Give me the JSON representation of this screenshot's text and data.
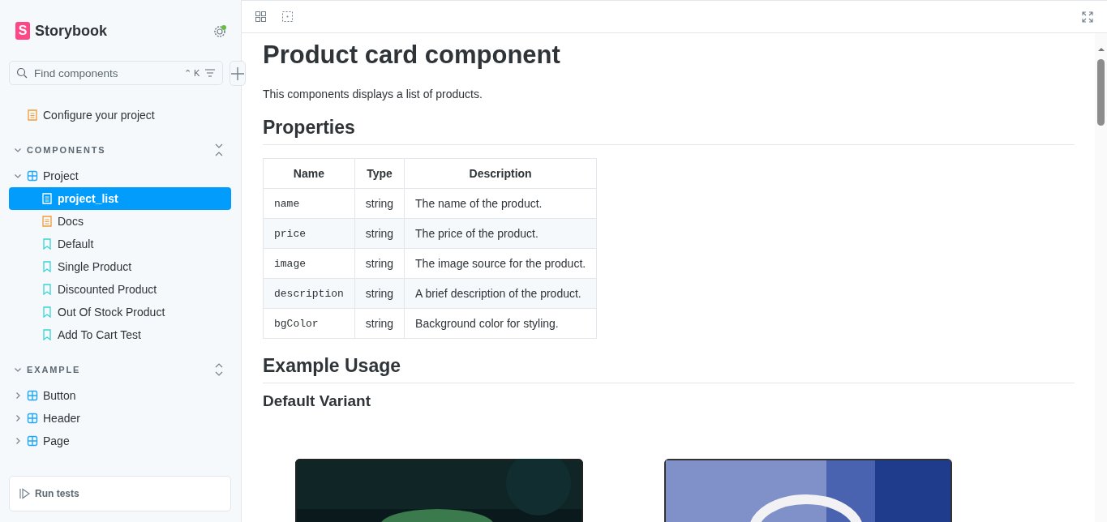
{
  "sidebar": {
    "logo_mark": "S",
    "brand": "Storybook",
    "search": {
      "placeholder": "Find components",
      "shortcut": "⌃ K"
    },
    "top_items": [
      {
        "kind": "doc",
        "label": "Configure your project",
        "selected": false
      }
    ],
    "sections": [
      {
        "title": "COMPONENTS",
        "expanded": true,
        "items": [
          {
            "kind": "component",
            "label": "Project",
            "expanded": true,
            "selected": false,
            "children": [
              {
                "kind": "doc",
                "label": "project_list",
                "selected": true
              },
              {
                "kind": "doc",
                "label": "Docs",
                "selected": false
              },
              {
                "kind": "story",
                "label": "Default",
                "selected": false
              },
              {
                "kind": "story",
                "label": "Single Product",
                "selected": false
              },
              {
                "kind": "story",
                "label": "Discounted Product",
                "selected": false
              },
              {
                "kind": "story",
                "label": "Out Of Stock Product",
                "selected": false
              },
              {
                "kind": "story",
                "label": "Add To Cart Test",
                "selected": false
              }
            ]
          }
        ]
      },
      {
        "title": "EXAMPLE",
        "expanded": true,
        "items": [
          {
            "kind": "component",
            "label": "Button",
            "expanded": false,
            "selected": false
          },
          {
            "kind": "component",
            "label": "Header",
            "expanded": false,
            "selected": false
          },
          {
            "kind": "component",
            "label": "Page",
            "expanded": false,
            "selected": false
          }
        ]
      }
    ],
    "run_tests": "Run tests"
  },
  "doc": {
    "title": "Product card component",
    "intro": "This components displays a list of products.",
    "properties_heading": "Properties",
    "table": {
      "columns": [
        "Name",
        "Type",
        "Description"
      ],
      "rows": [
        [
          "name",
          "string",
          "The name of the product."
        ],
        [
          "price",
          "string",
          "The price of the product."
        ],
        [
          "image",
          "string",
          "The image source for the product."
        ],
        [
          "description",
          "string",
          "A brief description of the product."
        ],
        [
          "bgColor",
          "string",
          "Background color for styling."
        ]
      ]
    },
    "usage_heading": "Example Usage",
    "variant_heading": "Default Variant"
  }
}
